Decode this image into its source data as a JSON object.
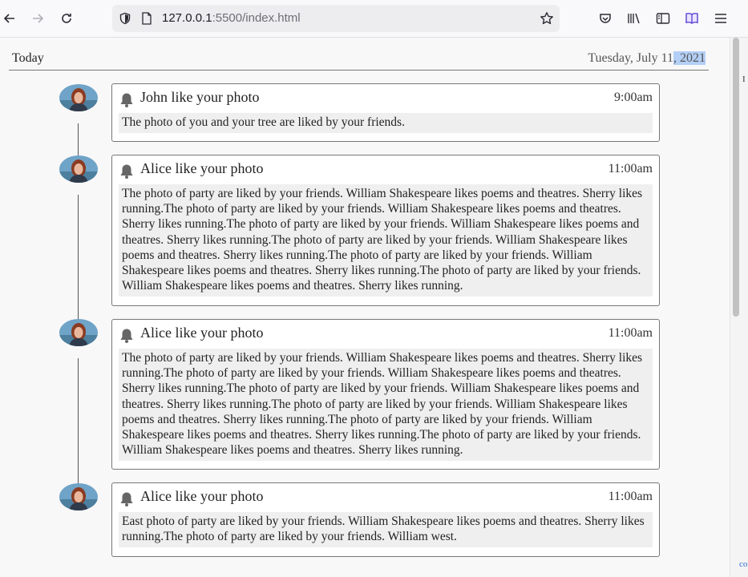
{
  "browser": {
    "url_host": "127.0.0.1",
    "url_rest": ":5500/index.html"
  },
  "timeline": {
    "header_left": "Today",
    "date_main": "Tuesday, July 11",
    "date_highlighted": ", 2021"
  },
  "notifications": [
    {
      "title": "John like your photo",
      "time": "9:00am",
      "body": "The photo of you and your tree are liked by your friends."
    },
    {
      "title": "Alice like your photo",
      "time": "11:00am",
      "body": "The photo of party are liked by your friends. William Shakespeare likes poems and theatres. Sherry likes running.The photo of party are liked by your friends. William Shakespeare likes poems and theatres. Sherry likes running.The photo of party are liked by your friends. William Shakespeare likes poems and theatres. Sherry likes running.The photo of party are liked by your friends. William Shakespeare likes poems and theatres. Sherry likes running.The photo of party are liked by your friends. William Shakespeare likes poems and theatres. Sherry likes running.The photo of party are liked by your friends. William Shakespeare likes poems and theatres. Sherry likes running."
    },
    {
      "title": "Alice like your photo",
      "time": "11:00am",
      "body": "The photo of party are liked by your friends. William Shakespeare likes poems and theatres. Sherry likes running.The photo of party are liked by your friends. William Shakespeare likes poems and theatres. Sherry likes running.The photo of party are liked by your friends. William Shakespeare likes poems and theatres. Sherry likes running.The photo of party are liked by your friends. William Shakespeare likes poems and theatres. Sherry likes running.The photo of party are liked by your friends. William Shakespeare likes poems and theatres. Sherry likes running.The photo of party are liked by your friends. William Shakespeare likes poems and theatres. Sherry likes running."
    },
    {
      "title": "Alice like your photo",
      "time": "11:00am",
      "body": "East photo of party are liked by your friends. William Shakespeare likes poems and theatres. Sherry likes running.The photo of party are liked by your friends. William west."
    }
  ],
  "side_fragments": {
    "top": "I",
    "bottom": "co"
  }
}
